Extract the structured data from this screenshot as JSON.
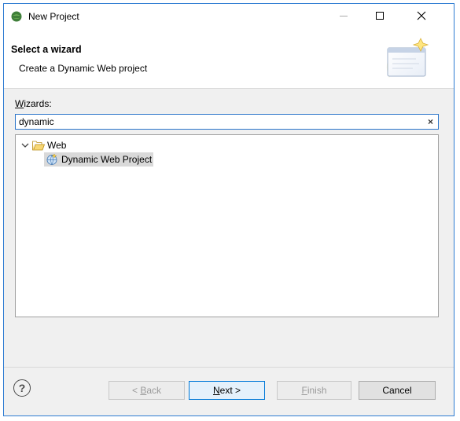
{
  "window": {
    "title": "New Project",
    "close_glyph": "✕"
  },
  "banner": {
    "title": "Select a wizard",
    "description": "Create a Dynamic Web project"
  },
  "wizards": {
    "label_accel": "W",
    "label_rest": "izards:",
    "filter_value": "dynamic",
    "clear_glyph": "×"
  },
  "tree": {
    "folder_label": "Web",
    "item_label": "Dynamic Web Project"
  },
  "footer": {
    "help_glyph": "?",
    "back_accel": "B",
    "back_rest": "ack",
    "back_prefix": "< ",
    "next_accel": "N",
    "next_rest": "ext >",
    "finish_accel": "F",
    "finish_rest": "inish",
    "cancel_label": "Cancel"
  },
  "colors": {
    "accent": "#0078d7",
    "window_border": "#2d7bd2",
    "selection": "#d9d9d9"
  }
}
